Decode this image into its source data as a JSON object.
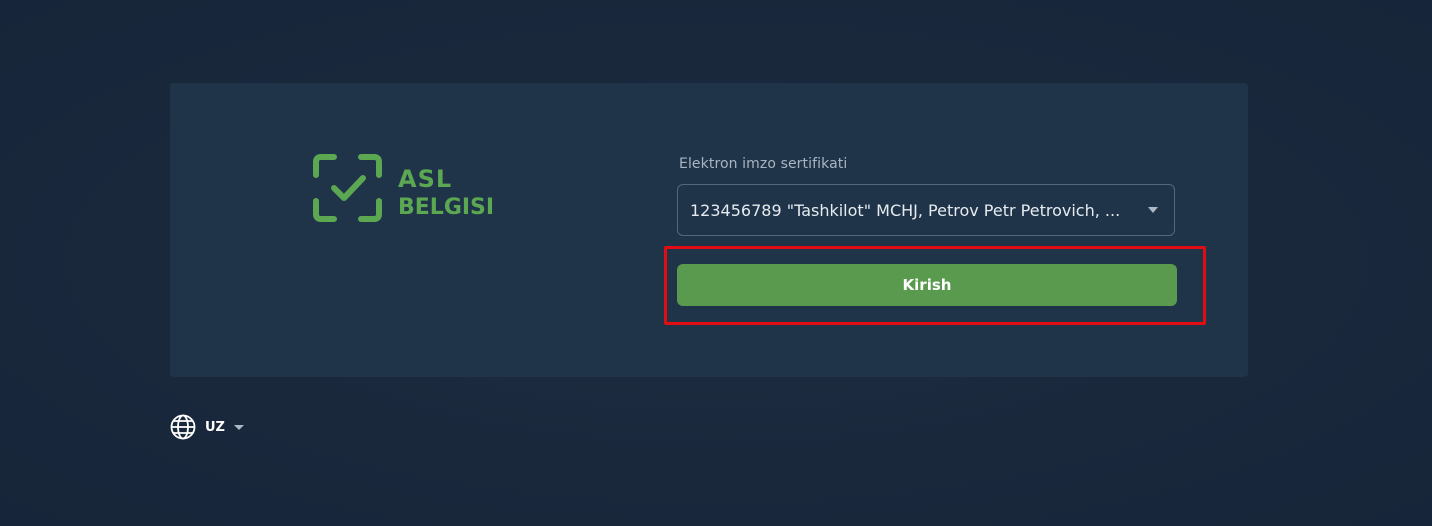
{
  "brand": {
    "logo_text_line1": "ASL",
    "logo_text_line2": "BELGISI",
    "logo_color": "#5ba752"
  },
  "login": {
    "certificate_label": "Elektron imzo sertifikati",
    "certificate_selected": "123456789 \"Tashkilot\" MCHJ, Petrov Petr Petrovich, ...",
    "submit_label": "Kirish",
    "submit_color": "#599a4e",
    "highlight_color": "#e10d12"
  },
  "language": {
    "current": "UZ",
    "icon": "globe-icon"
  }
}
